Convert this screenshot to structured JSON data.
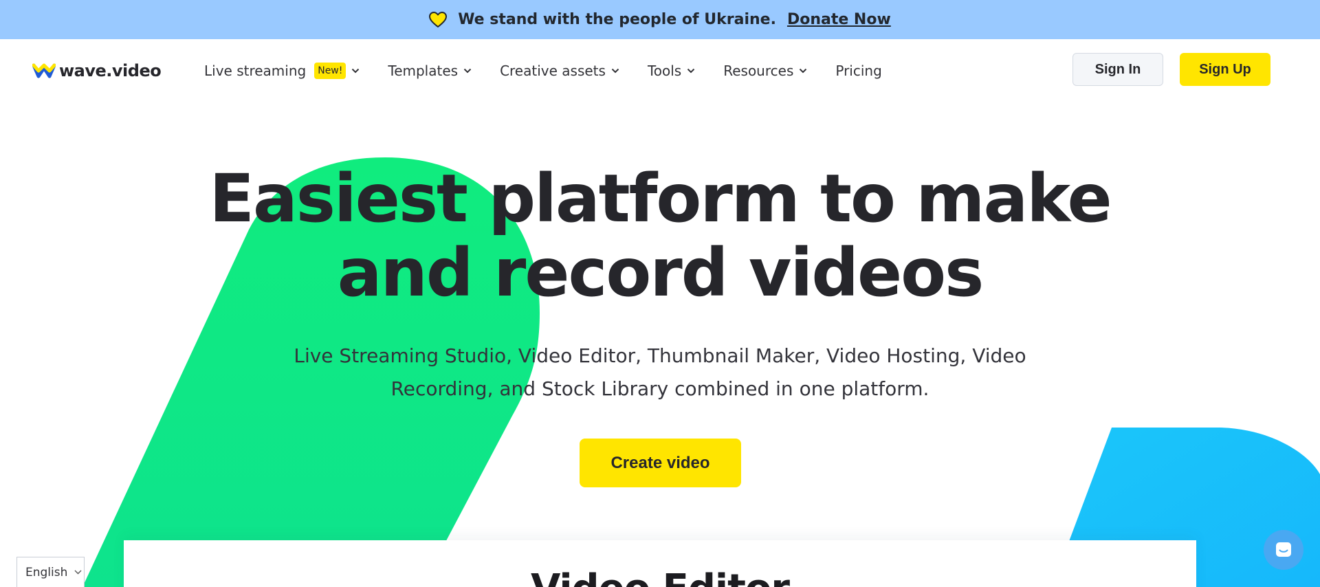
{
  "banner": {
    "icon": "heart-icon",
    "message": "We stand with the people of Ukraine.",
    "donate_label": "Donate Now",
    "background": "#99c9ff",
    "heart_color": "#ffe500"
  },
  "header": {
    "logo_text": "wave.video",
    "logo_colors": {
      "top": "#ffe500",
      "bottom": "#1f5bd6"
    },
    "nav": [
      {
        "label": "Live streaming",
        "badge": "New!",
        "icon": "chevron-down-icon"
      },
      {
        "label": "Templates",
        "icon": "chevron-down-icon"
      },
      {
        "label": "Creative assets",
        "icon": "chevron-down-icon"
      },
      {
        "label": "Tools",
        "icon": "chevron-down-icon"
      },
      {
        "label": "Resources",
        "icon": "chevron-down-icon"
      },
      {
        "label": "Pricing"
      }
    ],
    "signin_label": "Sign In",
    "signup_label": "Sign Up"
  },
  "hero": {
    "title_line1": "Easiest platform to make",
    "title_line2": "and record videos",
    "subtitle_line1": "Live Streaming Studio, Video Editor, Thumbnail Maker, Video Hosting, Video",
    "subtitle_line2": "Recording, and Stock Library combined in one platform.",
    "cta_label": "Create video"
  },
  "card": {
    "title": "Video Editor"
  },
  "language": {
    "selected": "English",
    "icon": "chevron-down-icon"
  },
  "chat": {
    "icon": "chat-icon"
  },
  "colors": {
    "accent_yellow": "#ffe500",
    "shape_green": "#10e882",
    "shape_blue": "#1cc2fb",
    "text_dark": "#26262b"
  }
}
